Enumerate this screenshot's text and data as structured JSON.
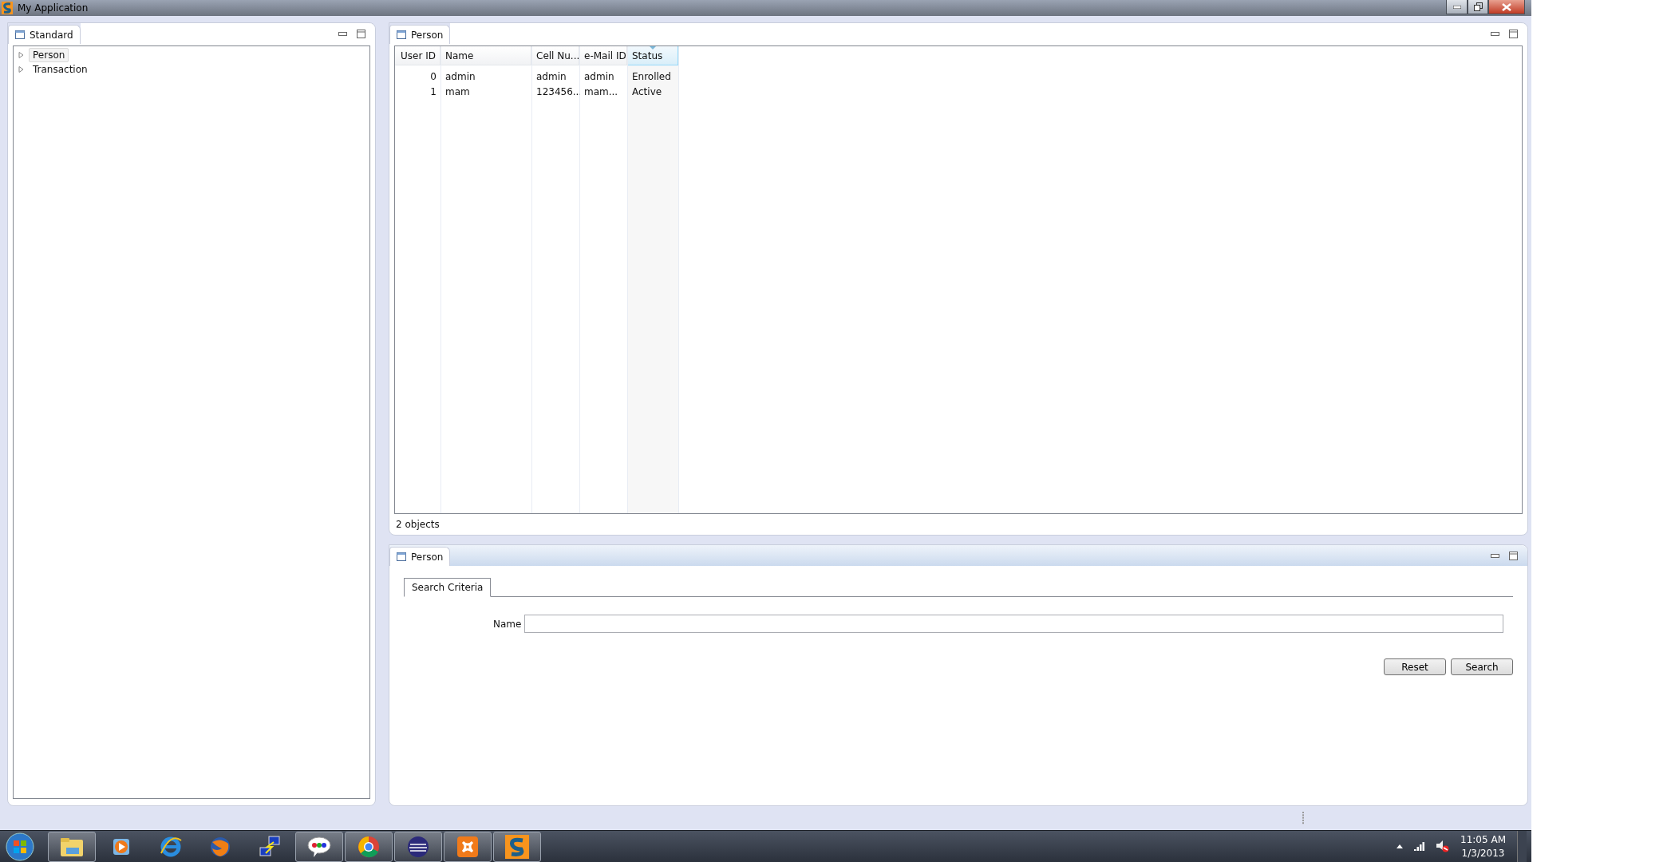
{
  "window": {
    "title": "My Application"
  },
  "navigator": {
    "tab": "Standard",
    "items": [
      {
        "label": "Person",
        "selected": true,
        "expanded": false
      },
      {
        "label": "Transaction",
        "selected": false,
        "expanded": false
      }
    ]
  },
  "list_panel": {
    "tab": "Person",
    "active": false,
    "columns": [
      {
        "label": "User ID",
        "kind": "number",
        "sorted": false
      },
      {
        "label": "Name",
        "kind": "text",
        "sorted": false
      },
      {
        "label": "Cell Nu...",
        "kind": "text",
        "sorted": false
      },
      {
        "label": "e-Mail ID",
        "kind": "text",
        "sorted": false
      },
      {
        "label": "Status",
        "kind": "text",
        "sorted": true
      }
    ],
    "rows": [
      [
        "0",
        "admin",
        "admin",
        "admin",
        "Enrolled"
      ],
      [
        "1",
        "mam",
        "123456...",
        "mam...",
        "Active"
      ]
    ],
    "footer": "2 objects"
  },
  "search_panel": {
    "tab": "Person",
    "active": true,
    "subtabs": [
      {
        "label": "Search Criteria",
        "selected": true
      }
    ],
    "field_label": "Name",
    "buttons": [
      "Reset",
      "Search"
    ]
  },
  "taskbar": {
    "apps": [
      {
        "kind": "folder",
        "open": true
      },
      {
        "kind": "media",
        "open": false
      },
      {
        "kind": "browser-e",
        "open": false
      },
      {
        "kind": "fox",
        "open": false
      },
      {
        "kind": "network",
        "open": false
      },
      {
        "kind": "talk",
        "open": true
      },
      {
        "kind": "chrome",
        "open": true
      },
      {
        "kind": "sphere",
        "open": true
      },
      {
        "kind": "xampp",
        "open": true
      },
      {
        "kind": "s-app",
        "open": true
      }
    ],
    "time": "11:05 AM",
    "date": "1/3/2013"
  }
}
